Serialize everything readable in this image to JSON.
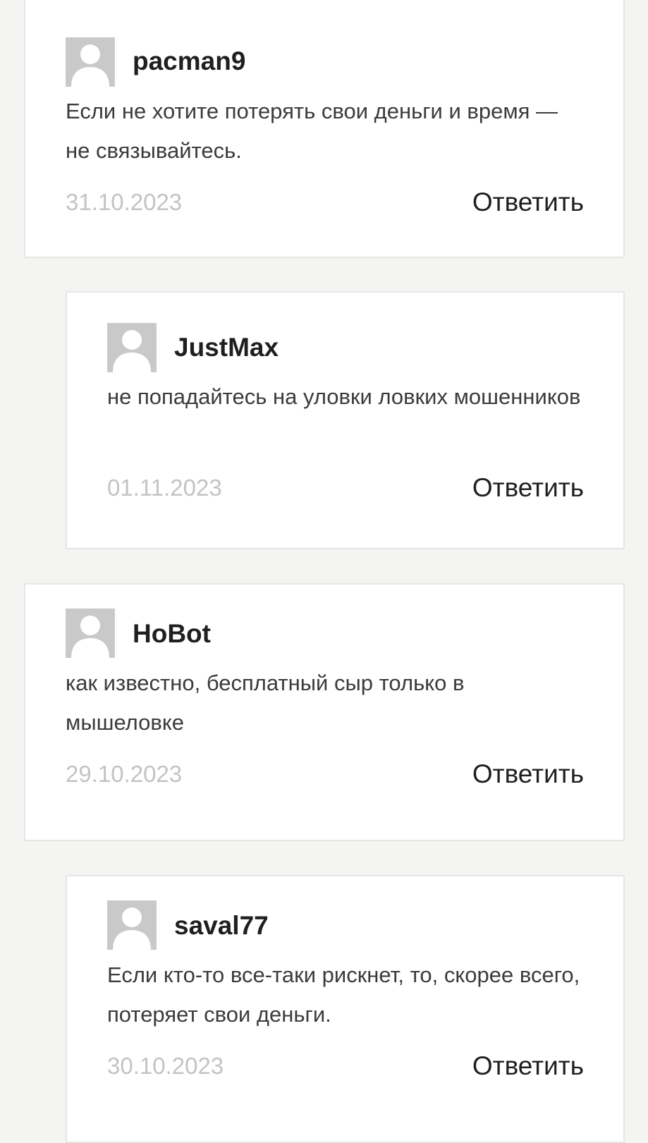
{
  "comments": [
    {
      "author": "pacman9",
      "text": "Если не хотите потерять свои деньги и время — не связывайтесь.",
      "date": "31.10.2023",
      "reply_label": "Ответить",
      "avatar_icon": "default-avatar-icon"
    },
    {
      "author": "JustMax",
      "text": "не попадайтесь на уловки ловких мошенников",
      "date": "01.11.2023",
      "reply_label": "Ответить",
      "avatar_icon": "default-avatar-icon"
    },
    {
      "author": "HoBot",
      "text": "как известно, бесплатный сыр только в мышеловке",
      "date": "29.10.2023",
      "reply_label": "Ответить",
      "avatar_icon": "default-avatar-icon"
    },
    {
      "author": "saval77",
      "text": "Если кто-то все-таки рискнет, то, скорее всего, потеряет свои деньги.",
      "date": "30.10.2023",
      "reply_label": "Ответить",
      "avatar_icon": "default-avatar-icon"
    }
  ],
  "colors": {
    "page_background": "#f4f4f2",
    "card_background": "#ffffff",
    "card_border": "#e6e6e4",
    "avatar_background": "#c9c9c9",
    "date_text": "#c3c3c3",
    "author_text": "#1f1f1f"
  }
}
